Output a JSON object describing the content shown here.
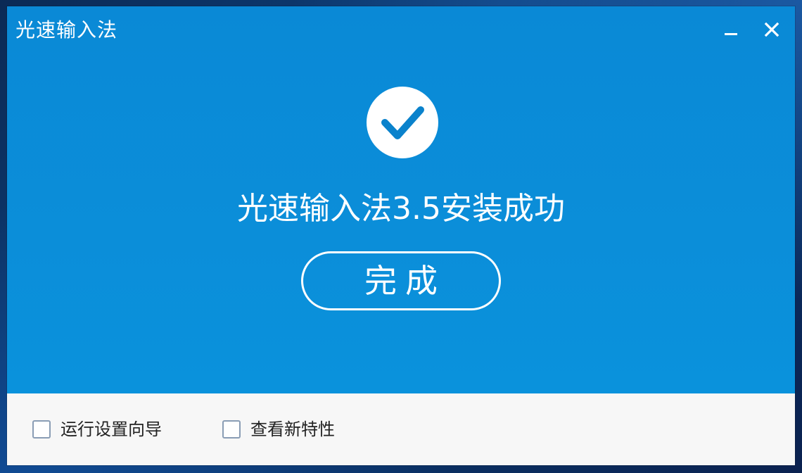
{
  "window": {
    "title": "光速输入法"
  },
  "title_controls": {
    "minimize_icon": "minimize-icon",
    "close_icon": "close-icon"
  },
  "main": {
    "status_icon": "check-circle-icon",
    "success_message": "光速输入法3.5安装成功",
    "finish_button": "完成"
  },
  "footer": {
    "options": [
      {
        "label": "运行设置向导",
        "checked": false
      },
      {
        "label": "查看新特性",
        "checked": false
      }
    ]
  },
  "colors": {
    "accent_blue": "#0a8bd6",
    "footer_bg": "#f7f7f7",
    "text_white": "#ffffff"
  }
}
